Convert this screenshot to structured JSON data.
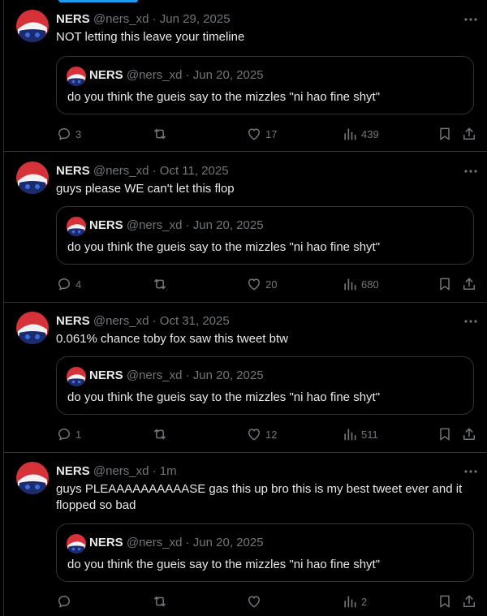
{
  "colors": {
    "background": "#000000",
    "text_primary": "#e7e9ea",
    "text_secondary": "#71767b",
    "border": "#2f3336",
    "accent": "#1d9bf0"
  },
  "icons": {
    "reply": "reply-icon",
    "retweet": "retweet-icon",
    "like": "heart-icon",
    "views": "views-icon",
    "bookmark": "bookmark-icon",
    "share": "share-icon",
    "more": "more-icon"
  },
  "tweets": [
    {
      "name": "NERS",
      "handle": "@ners_xd",
      "sep": "·",
      "time": "Jun 29, 2025",
      "text": "NOT letting this leave your timeline",
      "quote": {
        "name": "NERS",
        "handle": "@ners_xd",
        "sep": "·",
        "time": "Jun 20, 2025",
        "text": "do you think the gueis say to the mizzles \"ni hao fine shyt\""
      },
      "replies": "3",
      "retweets": "",
      "likes": "17",
      "views": "439"
    },
    {
      "name": "NERS",
      "handle": "@ners_xd",
      "sep": "·",
      "time": "Oct 11, 2025",
      "text": "guys please WE can't let this flop",
      "quote": {
        "name": "NERS",
        "handle": "@ners_xd",
        "sep": "·",
        "time": "Jun 20, 2025",
        "text": "do you think the gueis say to the mizzles \"ni hao fine shyt\""
      },
      "replies": "4",
      "retweets": "",
      "likes": "20",
      "views": "680"
    },
    {
      "name": "NERS",
      "handle": "@ners_xd",
      "sep": "·",
      "time": "Oct 31, 2025",
      "text": "0.061% chance toby fox saw this tweet btw",
      "quote": {
        "name": "NERS",
        "handle": "@ners_xd",
        "sep": "·",
        "time": "Jun 20, 2025",
        "text": "do you think the gueis say to the mizzles \"ni hao fine shyt\""
      },
      "replies": "1",
      "retweets": "",
      "likes": "12",
      "views": "511"
    },
    {
      "name": "NERS",
      "handle": "@ners_xd",
      "sep": "·",
      "time": "1m",
      "text": "guys PLEAAAAAAAAAASE gas this up bro this is my best tweet ever and it flopped so bad",
      "quote": {
        "name": "NERS",
        "handle": "@ners_xd",
        "sep": "·",
        "time": "Jun 20, 2025",
        "text": "do you think the gueis say to the mizzles \"ni hao fine shyt\""
      },
      "replies": "",
      "retweets": "",
      "likes": "",
      "views": "2"
    }
  ]
}
